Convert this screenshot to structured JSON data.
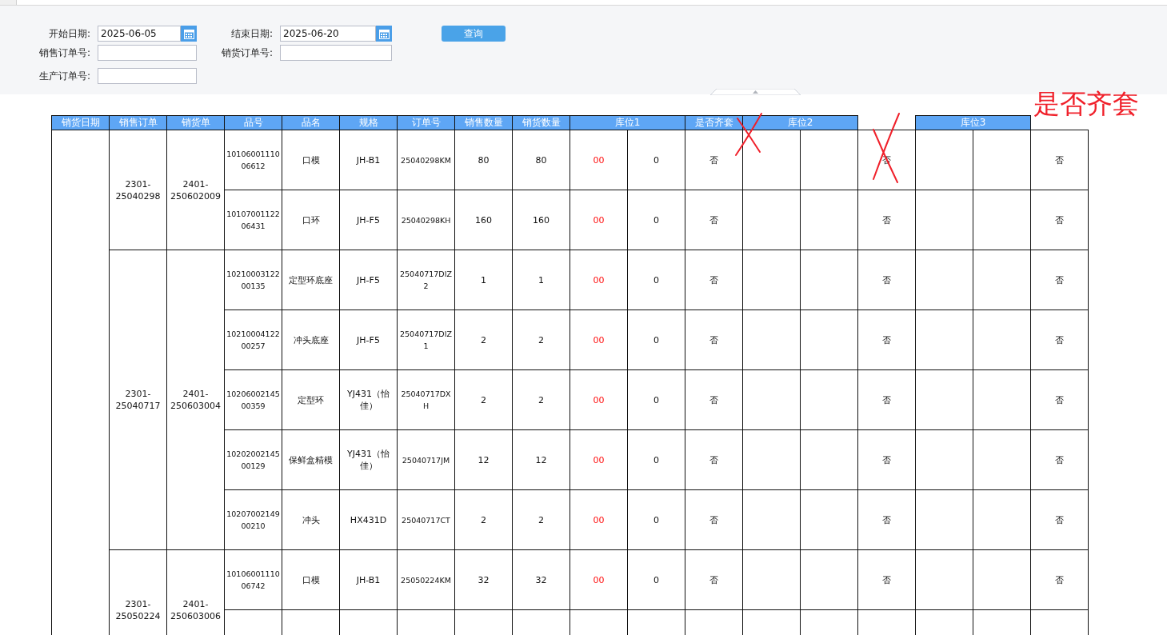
{
  "filters": {
    "rows": [
      [
        {
          "kind": "date",
          "label": "开始日期:",
          "value": "2025-06-05"
        },
        {
          "kind": "date",
          "label": "结束日期:",
          "value": "2025-06-20"
        }
      ],
      [
        {
          "kind": "text",
          "label": "销售订单号:"
        },
        {
          "kind": "text",
          "label": "销货订单号:"
        }
      ],
      [
        {
          "kind": "text",
          "label": "生产订单号:"
        }
      ]
    ],
    "query_button": "查询"
  },
  "table": {
    "headers": [
      {
        "kind": "single",
        "label": "销货日期"
      },
      {
        "kind": "single",
        "label": "销售订单"
      },
      {
        "kind": "single",
        "label": "销货单"
      },
      {
        "kind": "single",
        "label": "品号"
      },
      {
        "kind": "single",
        "label": "品名"
      },
      {
        "kind": "single",
        "label": "规格"
      },
      {
        "kind": "single",
        "label": "订单号"
      },
      {
        "kind": "single",
        "label": "销售数量"
      },
      {
        "kind": "single",
        "label": "销货数量"
      },
      {
        "kind": "pair",
        "label": "库位1"
      },
      {
        "kind": "single",
        "label": "是否齐套"
      },
      {
        "kind": "pair",
        "label": "库位2"
      },
      {
        "kind": "blank"
      },
      {
        "kind": "pair",
        "label": "库位3"
      },
      {
        "kind": "blank"
      }
    ],
    "groups": [
      {
        "sales_order": "2301-25040298",
        "delivery_order": "2401-250602009",
        "items": [
          {
            "kind": "full",
            "part_no": "1010600111006612",
            "name": "口模",
            "spec": "JH-B1",
            "order_no": "25040298KM",
            "sales_qty": "80",
            "delivery_qty": "80",
            "location_1a": "00",
            "location_1b": "0",
            "complete": "否",
            "column_15": "否",
            "column_18": "否"
          },
          {
            "kind": "full",
            "part_no": "1010700112206431",
            "name": "口环",
            "spec": "JH-F5",
            "order_no": "25040298KH",
            "sales_qty": "160",
            "delivery_qty": "160",
            "location_1a": "00",
            "location_1b": "0",
            "complete": "否",
            "column_15": "否",
            "column_18": "否"
          }
        ]
      },
      {
        "sales_order": "2301-25040717",
        "delivery_order": "2401-250603004",
        "items": [
          {
            "kind": "full",
            "part_no": "1021000312200135",
            "name": "定型环底座",
            "spec": "JH-F5",
            "order_no": "25040717DIZ2",
            "sales_qty": "1",
            "delivery_qty": "1",
            "location_1a": "00",
            "location_1b": "0",
            "complete": "否",
            "column_15": "否",
            "column_18": "否"
          },
          {
            "kind": "full",
            "part_no": "1021000412200257",
            "name": "冲头底座",
            "spec": "JH-F5",
            "order_no": "25040717DIZ1",
            "sales_qty": "2",
            "delivery_qty": "2",
            "location_1a": "00",
            "location_1b": "0",
            "complete": "否",
            "column_15": "否",
            "column_18": "否"
          },
          {
            "kind": "full",
            "part_no": "1020600214500359",
            "name": "定型环",
            "spec": "YJ431（怡佳）",
            "order_no": "25040717DXH",
            "sales_qty": "2",
            "delivery_qty": "2",
            "location_1a": "00",
            "location_1b": "0",
            "complete": "否",
            "column_15": "否",
            "column_18": "否"
          },
          {
            "kind": "full",
            "part_no": "1020200214500129",
            "name": "保鲜盒精模",
            "spec": "YJ431（怡佳）",
            "order_no": "25040717JM",
            "sales_qty": "12",
            "delivery_qty": "12",
            "location_1a": "00",
            "location_1b": "0",
            "complete": "否",
            "column_15": "否",
            "column_18": "否"
          },
          {
            "kind": "full",
            "part_no": "1020700214900210",
            "name": "冲头",
            "spec": "HX431D",
            "order_no": "25040717CT",
            "sales_qty": "2",
            "delivery_qty": "2",
            "location_1a": "00",
            "location_1b": "0",
            "complete": "否",
            "column_15": "否",
            "column_18": "否"
          }
        ]
      },
      {
        "sales_order": "2301-25050224",
        "delivery_order": "2401-250603006",
        "items": [
          {
            "kind": "full",
            "part_no": "1010600111006742",
            "name": "口模",
            "spec": "JH-B1",
            "order_no": "25050224KM",
            "sales_qty": "32",
            "delivery_qty": "32",
            "location_1a": "00",
            "location_1b": "0",
            "complete": "否",
            "column_15": "否",
            "column_18": "否"
          },
          {
            "kind": "partial"
          }
        ]
      }
    ]
  },
  "annotations": [
    {
      "kind": "cross"
    },
    {
      "kind": "cross"
    },
    {
      "kind": "text",
      "text": "是否齐套"
    }
  ]
}
